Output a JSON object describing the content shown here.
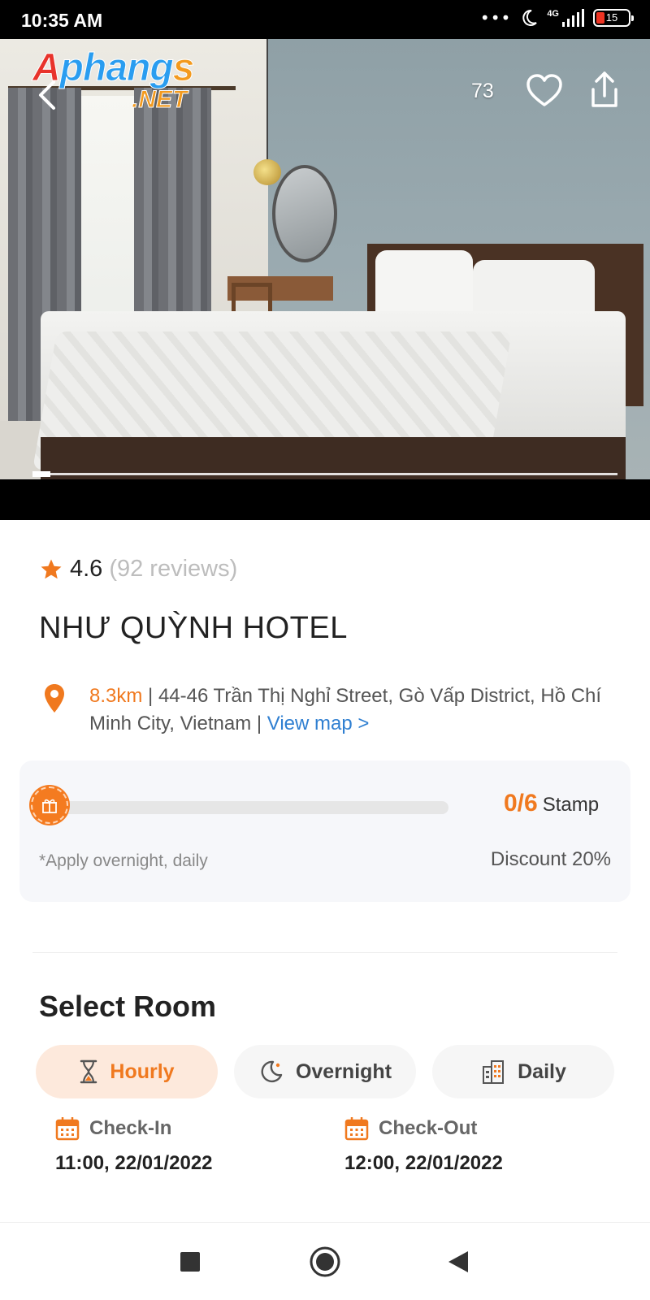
{
  "status_bar": {
    "time": "10:35 AM",
    "network": "4G",
    "battery": "15",
    "icons": [
      "more-dots-icon",
      "moon-icon",
      "signal-icon",
      "battery-icon"
    ]
  },
  "hero": {
    "logo_text": "Aphangs",
    "logo_subtext": ".NET",
    "favorite_count": "73",
    "image_progress": 0.03,
    "icons": [
      "back-icon",
      "heart-icon",
      "share-icon"
    ]
  },
  "hotel": {
    "rating": "4.6",
    "reviews": "(92 reviews)",
    "name": "NHƯ QUỲNH HOTEL",
    "distance": "8.3km",
    "address_separator": " | ",
    "address": "44-46 Trần Thị Nghỉ Street, Gò Vấp District, Hồ Chí Minh City, Vietnam",
    "address_separator2": " | ",
    "view_map": "View map >"
  },
  "stamp": {
    "count": "0/6",
    "label": "Stamp",
    "progress": 0,
    "note": "*Apply overnight, daily",
    "discount": "Discount 20%"
  },
  "select_room": {
    "title": "Select Room",
    "tabs": [
      {
        "label": "Hourly",
        "icon": "hourglass-icon",
        "active": true
      },
      {
        "label": "Overnight",
        "icon": "moon-icon",
        "active": false
      },
      {
        "label": "Daily",
        "icon": "building-icon",
        "active": false
      }
    ],
    "check_in": {
      "label": "Check-In",
      "value": "11:00, 22/01/2022"
    },
    "check_out": {
      "label": "Check-Out",
      "value": "12:00, 22/01/2022"
    }
  },
  "colors": {
    "accent": "#f0791f",
    "link": "#2f7fd1",
    "active_tab_bg": "#fde9dc"
  },
  "nav_bar": {
    "buttons": [
      "recent-apps-icon",
      "home-icon",
      "back-triangle-icon"
    ]
  }
}
